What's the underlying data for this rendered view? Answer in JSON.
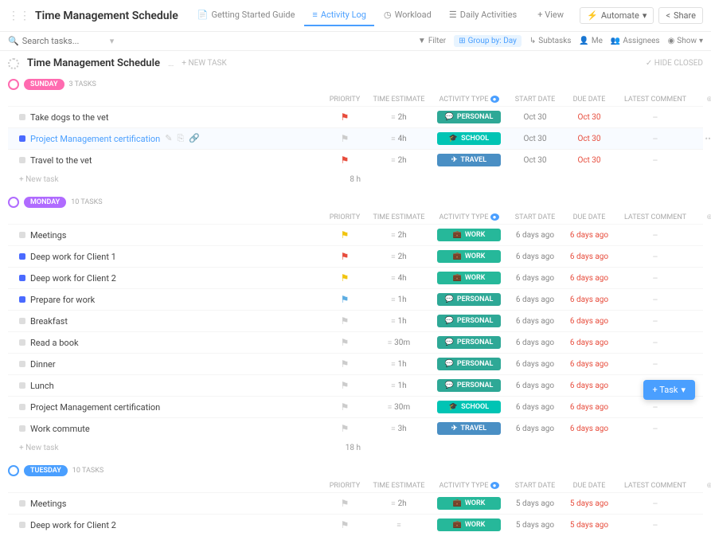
{
  "header": {
    "title": "Time Management Schedule",
    "tabs": [
      {
        "icon": "📄",
        "label": "Getting Started Guide",
        "active": false
      },
      {
        "icon": "≡",
        "label": "Activity Log",
        "active": true
      },
      {
        "icon": "◷",
        "label": "Workload",
        "active": false
      },
      {
        "icon": "☰",
        "label": "Daily Activities",
        "active": false
      }
    ],
    "addView": "+ View",
    "automate": "Automate",
    "share": "Share"
  },
  "search": {
    "placeholder": "Search tasks...",
    "toolbar": {
      "filter": "Filter",
      "groupby": "Group by: Day",
      "subtasks": "Subtasks",
      "me": "Me",
      "assignees": "Assignees",
      "show": "Show"
    }
  },
  "section": {
    "title": "Time Management Schedule",
    "newtask": "+ NEW TASK",
    "hideClosed": "✓ HIDE CLOSED"
  },
  "columns": {
    "priority": "PRIORITY",
    "timeEst": "TIME ESTIMATE",
    "activity": "ACTIVITY TYPE",
    "start": "START DATE",
    "due": "DUE DATE",
    "comment": "LATEST COMMENT"
  },
  "groups": [
    {
      "day": "SUNDAY",
      "badgeClass": "badge-sunday",
      "circle": "pink",
      "count": "3 TASKS",
      "totalTime": "8 h",
      "newtask": "+ New task",
      "tasks": [
        {
          "sq": "sq-grey",
          "name": "Take dogs to the vet",
          "flag": "flag-red",
          "time": "2h",
          "act": "PERSONAL",
          "actClass": "act-personal",
          "actIcon": "💬",
          "start": "Oct 30",
          "due": "Oct 30"
        },
        {
          "sq": "sq-blue",
          "name": "Project Management certification",
          "link": true,
          "selected": true,
          "flag": "flag-grey",
          "time": "4h",
          "act": "SCHOOL",
          "actClass": "act-school",
          "actIcon": "🎓",
          "start": "Oct 30",
          "due": "Oct 30",
          "more": true
        },
        {
          "sq": "sq-grey",
          "name": "Travel to the vet",
          "flag": "flag-red",
          "time": "2h",
          "act": "TRAVEL",
          "actClass": "act-travel",
          "actIcon": "✈",
          "start": "Oct 30",
          "due": "Oct 30"
        }
      ]
    },
    {
      "day": "MONDAY",
      "badgeClass": "badge-monday",
      "circle": "purple",
      "count": "10 TASKS",
      "totalTime": "18 h",
      "newtask": "+ New task",
      "tasks": [
        {
          "sq": "sq-grey",
          "name": "Meetings",
          "flag": "flag-yellow",
          "time": "2h",
          "act": "WORK",
          "actClass": "act-work",
          "actIcon": "💼",
          "start": "6 days ago",
          "due": "6 days ago",
          "dueRed": true
        },
        {
          "sq": "sq-blue",
          "name": "Deep work for Client 1",
          "flag": "flag-red",
          "time": "2h",
          "act": "WORK",
          "actClass": "act-work",
          "actIcon": "💼",
          "start": "6 days ago",
          "due": "6 days ago",
          "dueRed": true
        },
        {
          "sq": "sq-blue",
          "name": "Deep work for Client 2",
          "flag": "flag-yellow",
          "time": "4h",
          "act": "WORK",
          "actClass": "act-work",
          "actIcon": "💼",
          "start": "6 days ago",
          "due": "6 days ago",
          "dueRed": true
        },
        {
          "sq": "sq-blue",
          "name": "Prepare for work",
          "flag": "flag-blue",
          "time": "1h",
          "act": "PERSONAL",
          "actClass": "act-personal",
          "actIcon": "💬",
          "start": "6 days ago",
          "due": "6 days ago",
          "dueRed": true
        },
        {
          "sq": "sq-grey",
          "name": "Breakfast",
          "flag": "flag-grey",
          "time": "1h",
          "act": "PERSONAL",
          "actClass": "act-personal",
          "actIcon": "💬",
          "start": "6 days ago",
          "due": "6 days ago",
          "dueRed": true
        },
        {
          "sq": "sq-grey",
          "name": "Read a book",
          "flag": "flag-grey",
          "time": "30m",
          "act": "PERSONAL",
          "actClass": "act-personal",
          "actIcon": "💬",
          "start": "6 days ago",
          "due": "6 days ago",
          "dueRed": true
        },
        {
          "sq": "sq-grey",
          "name": "Dinner",
          "flag": "flag-grey",
          "time": "1h",
          "act": "PERSONAL",
          "actClass": "act-personal",
          "actIcon": "💬",
          "start": "6 days ago",
          "due": "6 days ago",
          "dueRed": true
        },
        {
          "sq": "sq-grey",
          "name": "Lunch",
          "flag": "flag-grey",
          "time": "1h",
          "act": "PERSONAL",
          "actClass": "act-personal",
          "actIcon": "💬",
          "start": "6 days ago",
          "due": "6 days ago",
          "dueRed": true
        },
        {
          "sq": "sq-grey",
          "name": "Project Management certification",
          "flag": "flag-grey",
          "time": "30m",
          "act": "SCHOOL",
          "actClass": "act-school",
          "actIcon": "🎓",
          "start": "6 days ago",
          "due": "6 days ago",
          "dueRed": true
        },
        {
          "sq": "sq-grey",
          "name": "Work commute",
          "flag": "flag-grey",
          "time": "3h",
          "act": "TRAVEL",
          "actClass": "act-travel",
          "actIcon": "✈",
          "start": "6 days ago",
          "due": "6 days ago",
          "dueRed": true
        }
      ]
    },
    {
      "day": "TUESDAY",
      "badgeClass": "badge-tuesday",
      "circle": "blue",
      "count": "10 TASKS",
      "totalTime": "",
      "newtask": "",
      "tasks": [
        {
          "sq": "sq-grey",
          "name": "Meetings",
          "flag": "flag-grey",
          "time": "2h",
          "act": "WORK",
          "actClass": "act-work",
          "actIcon": "💼",
          "start": "5 days ago",
          "due": "5 days ago",
          "dueRed": true
        },
        {
          "sq": "sq-grey",
          "name": "Deep work for Client 2",
          "flag": "flag-grey",
          "time": "",
          "act": "WORK",
          "actClass": "act-work",
          "actIcon": "💼",
          "start": "5 days ago",
          "due": "5 days ago",
          "dueRed": true
        }
      ]
    }
  ],
  "fab": "+ Task"
}
